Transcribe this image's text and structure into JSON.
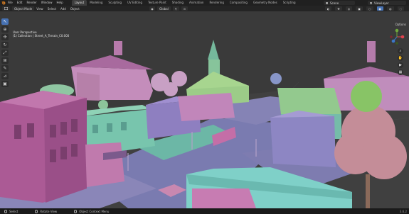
{
  "topbar": {
    "menu": [
      "File",
      "Edit",
      "Render",
      "Window",
      "Help"
    ],
    "workspaces": [
      "Layout",
      "Modeling",
      "Sculpting",
      "UV Editing",
      "Texture Paint",
      "Shading",
      "Animation",
      "Rendering",
      "Compositing",
      "Geometry Nodes",
      "Scripting"
    ],
    "active_workspace": "Layout",
    "scene": "Scene",
    "view_layer": "ViewLayer"
  },
  "header": {
    "mode": "Object Mode",
    "menus": [
      "View",
      "Select",
      "Add",
      "Object"
    ],
    "transform": "Global"
  },
  "viewport": {
    "perspective": "User Perspective",
    "collection": "(1) Collection | Street_A_Terrain_C0.000"
  },
  "right": {
    "options": "Options"
  },
  "status": {
    "select": "Select",
    "rotate_view": "Rotate View",
    "context_menu": "Object Context Menu",
    "version": "3.6.2"
  },
  "colors": {
    "accent": "#4772b3",
    "building_pink": "#b874a0",
    "building_teal": "#73c3aa",
    "building_purple": "#8a7ab8",
    "roof_green": "#90c88a",
    "ground": "#3c3c3c"
  }
}
